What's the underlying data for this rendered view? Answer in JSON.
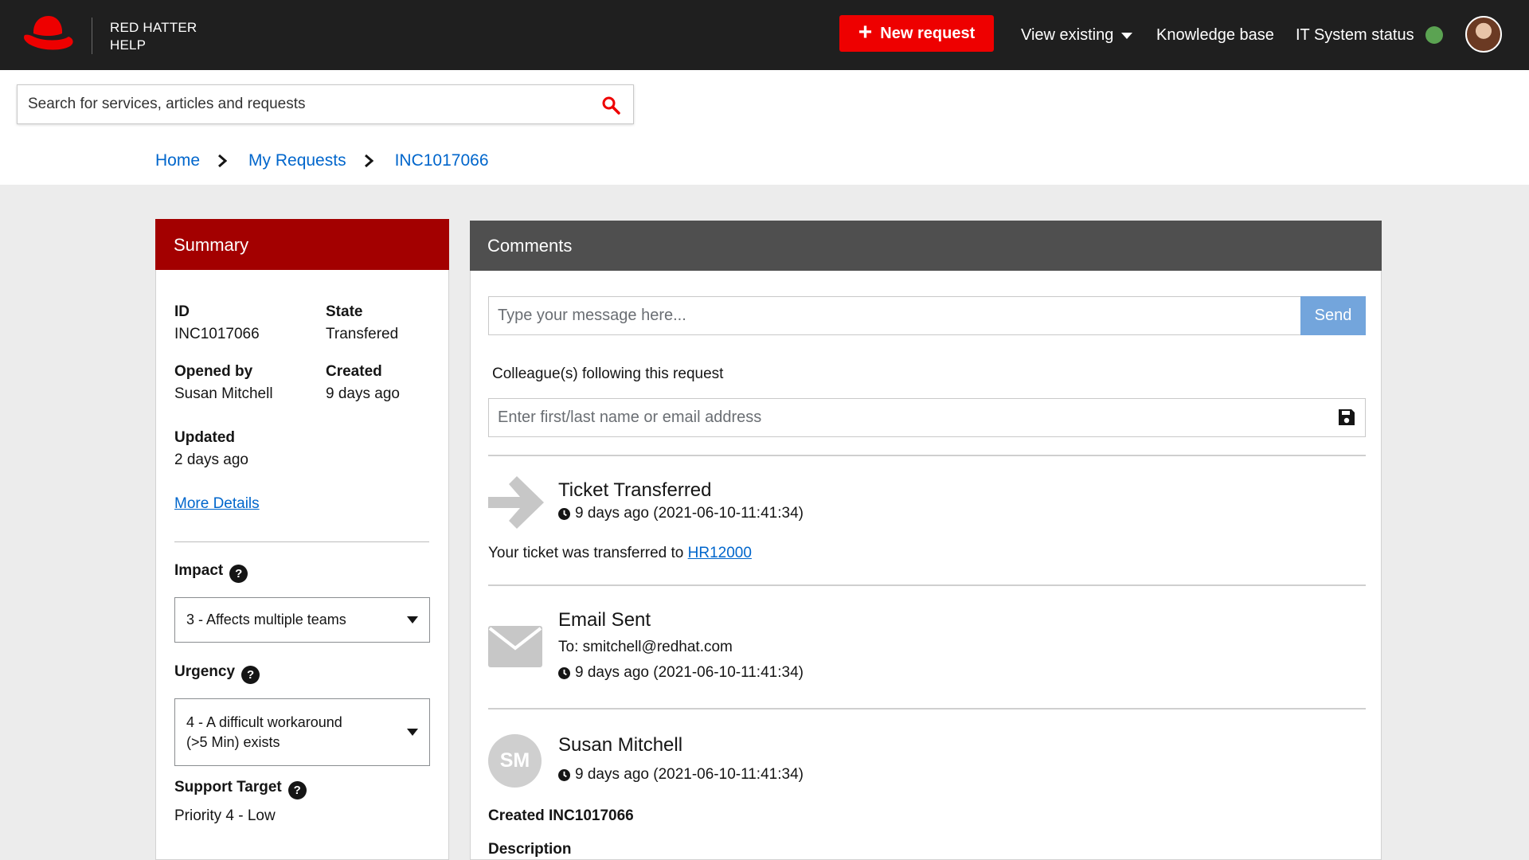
{
  "brand": {
    "line1": "RED HATTER",
    "line2": "HELP"
  },
  "topnav": {
    "new_request": "New request",
    "view_existing": "View existing",
    "knowledge_base": "Knowledge base",
    "it_status": "IT System status",
    "status_color": "#5ba352"
  },
  "search": {
    "placeholder": "Search for services, articles and requests"
  },
  "breadcrumb": {
    "home": "Home",
    "my_requests": "My Requests",
    "current": "INC1017066"
  },
  "summary": {
    "title": "Summary",
    "id_label": "ID",
    "id_value": "INC1017066",
    "state_label": "State",
    "state_value": "Transfered",
    "opened_label": "Opened by",
    "opened_value": "Susan Mitchell",
    "created_label": "Created",
    "created_value": "9 days ago",
    "updated_label": "Updated",
    "updated_value": "2 days ago",
    "more_details": "More Details",
    "impact_label": "Impact",
    "impact_value": "3 - Affects multiple teams",
    "urgency_label": "Urgency",
    "urgency_value_line1": "4 - A difficult workaround",
    "urgency_value_line2": "(>5 Min) exists",
    "support_label": "Support Target",
    "support_value": "Priority 4 - Low",
    "help_glyph": "?"
  },
  "comments": {
    "title": "Comments",
    "message_placeholder": "Type your message here...",
    "send": "Send",
    "following_label": "Colleague(s) following this request",
    "colleague_placeholder": "Enter first/last name or email address",
    "entries": [
      {
        "title": "Ticket Transferred",
        "time": "9 days ago (2021-06-10-11:41:34)",
        "body_prefix": "Your ticket was transferred to ",
        "body_link": "HR12000"
      },
      {
        "title": "Email Sent",
        "to": "To: smitchell@redhat.com",
        "time": "9 days ago (2021-06-10-11:41:34)"
      },
      {
        "title": "Susan Mitchell",
        "initials": "SM",
        "time": "9 days ago (2021-06-10-11:41:34)",
        "created": "Created INC1017066",
        "description_label": "Description"
      }
    ]
  }
}
